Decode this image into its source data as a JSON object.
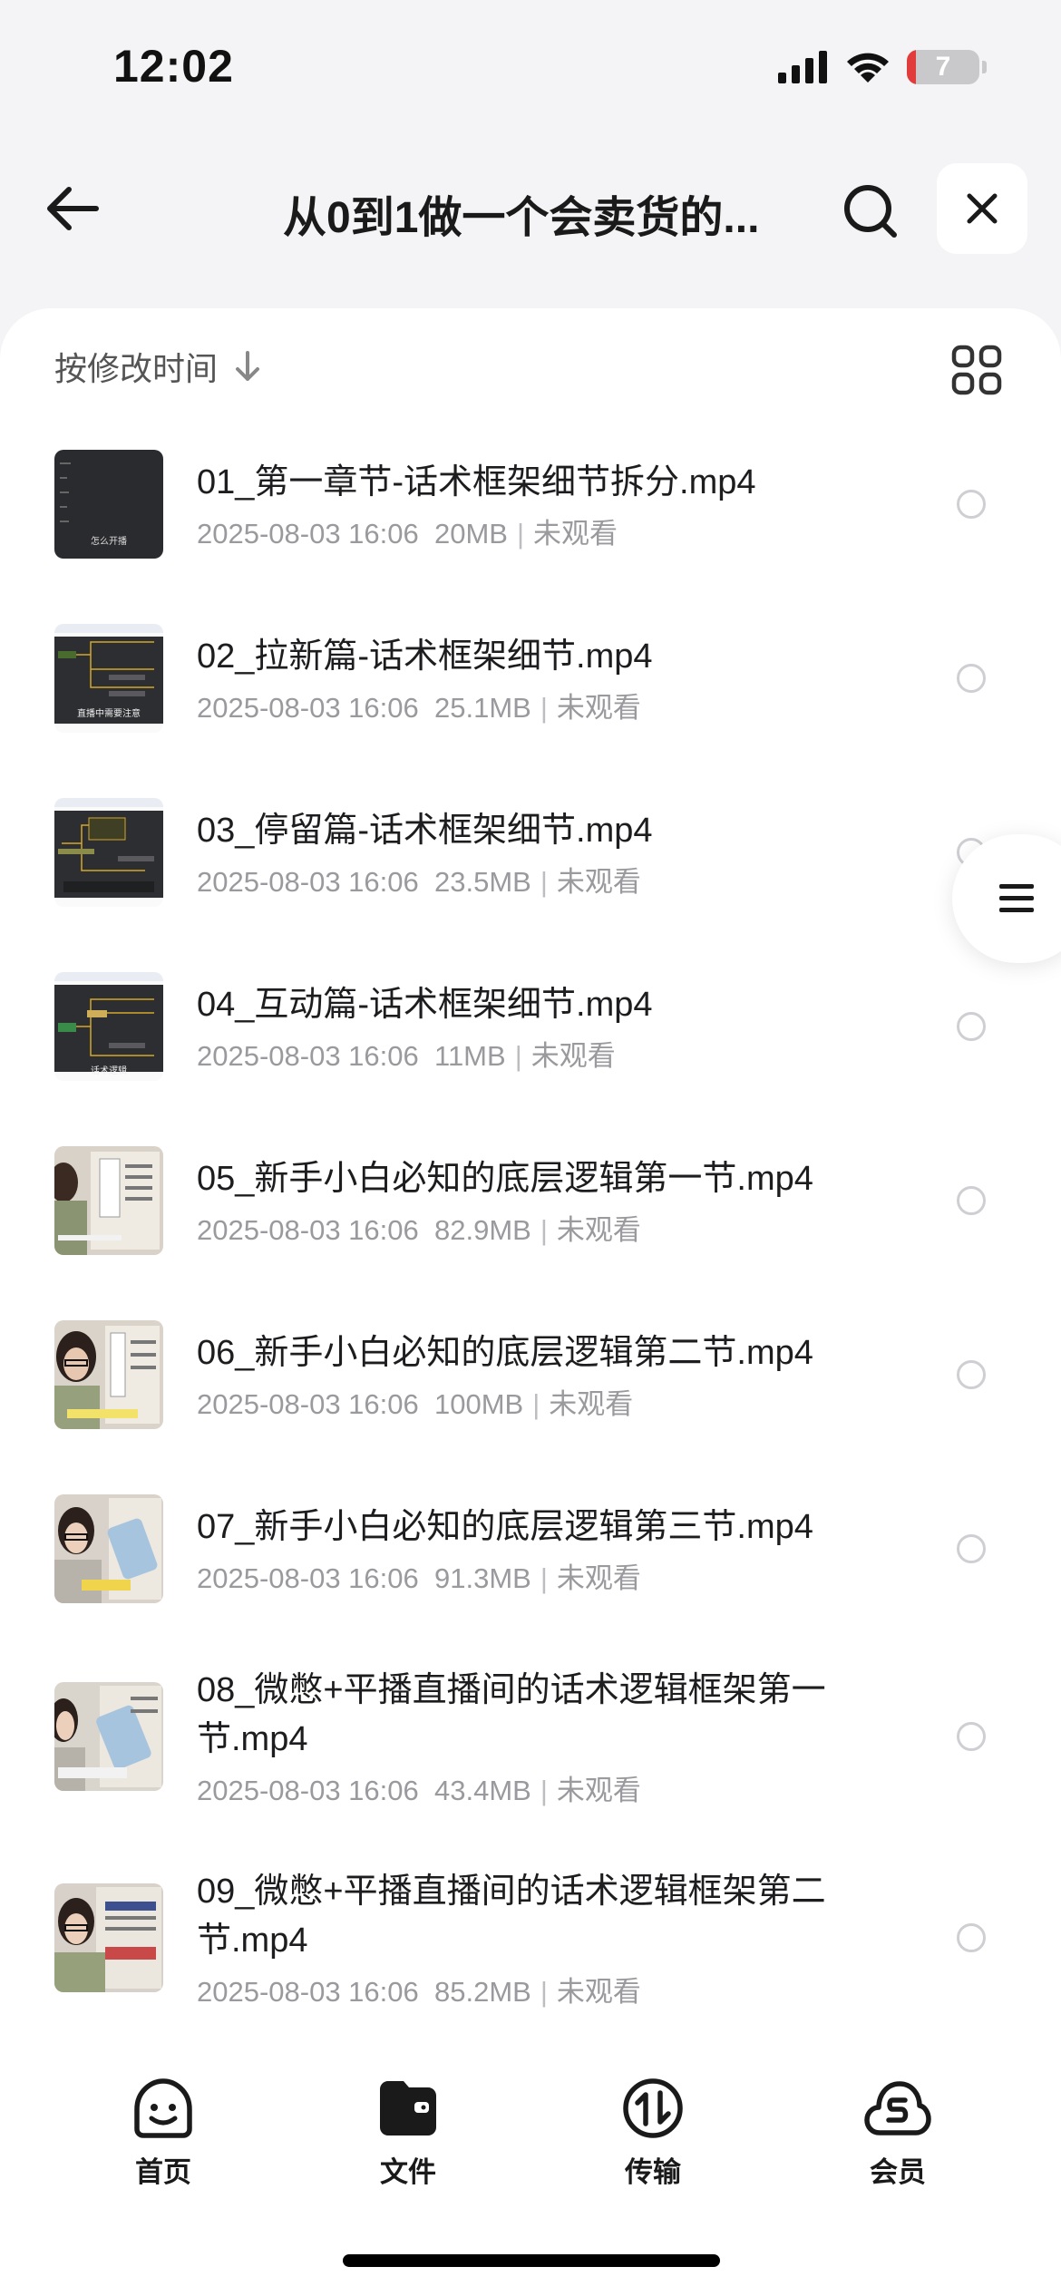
{
  "status_bar": {
    "time": "12:02",
    "battery_level": "7",
    "battery_color": "#e23b3b"
  },
  "header": {
    "title": "从0到1做一个会卖货的...",
    "back_icon": "arrow-left-icon",
    "search_icon": "search-icon",
    "close_icon": "close-icon"
  },
  "sort": {
    "label": "按修改时间",
    "direction_icon": "arrow-down-icon",
    "view_icon": "grid-view-icon"
  },
  "files": [
    {
      "name": "01_第一章节-话术框架细节拆分.mp4",
      "date": "2025-08-03 16:06",
      "size": "20MB",
      "status": "未观看"
    },
    {
      "name": "02_拉新篇-话术框架细节.mp4",
      "date": "2025-08-03 16:06",
      "size": "25.1MB",
      "status": "未观看"
    },
    {
      "name": "03_停留篇-话术框架细节.mp4",
      "date": "2025-08-03 16:06",
      "size": "23.5MB",
      "status": "未观看"
    },
    {
      "name": "04_互动篇-话术框架细节.mp4",
      "date": "2025-08-03 16:06",
      "size": "11MB",
      "status": "未观看"
    },
    {
      "name": "05_新手小白必知的底层逻辑第一节.mp4",
      "date": "2025-08-03 16:06",
      "size": "82.9MB",
      "status": "未观看"
    },
    {
      "name": "06_新手小白必知的底层逻辑第二节.mp4",
      "date": "2025-08-03 16:06",
      "size": "100MB",
      "status": "未观看"
    },
    {
      "name": "07_新手小白必知的底层逻辑第三节.mp4",
      "date": "2025-08-03 16:06",
      "size": "91.3MB",
      "status": "未观看"
    },
    {
      "name": "08_微憋+平播直播间的话术逻辑框架第一节.mp4",
      "date": "2025-08-03 16:06",
      "size": "43.4MB",
      "status": "未观看"
    },
    {
      "name": "09_微憋+平播直播间的话术逻辑框架第二节.mp4",
      "date": "2025-08-03 16:06",
      "size": "85.2MB",
      "status": "未观看"
    }
  ],
  "thumb_captions": [
    "怎么开播",
    "直播中需要注意",
    "话术逻辑"
  ],
  "floating_menu_icon": "list-menu-icon",
  "tabs": [
    {
      "label": "首页",
      "icon": "smiley-home-icon"
    },
    {
      "label": "文件",
      "icon": "folder-icon"
    },
    {
      "label": "传输",
      "icon": "transfer-icon"
    },
    {
      "label": "会员",
      "icon": "cloud-member-icon"
    }
  ]
}
